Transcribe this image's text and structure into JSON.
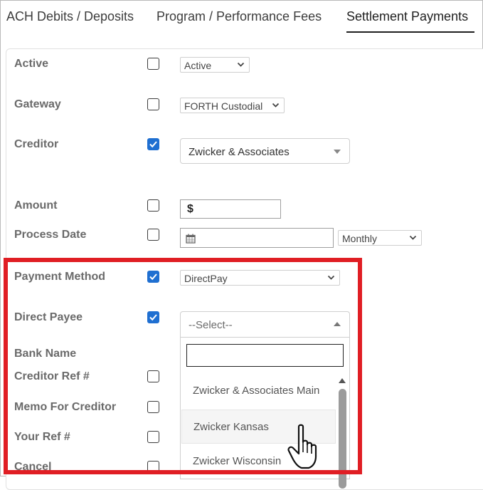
{
  "tabs": [
    {
      "label": "ACH Debits / Deposits"
    },
    {
      "label": "Program / Performance Fees"
    },
    {
      "label": "Settlement Payments",
      "active": true
    }
  ],
  "fields": {
    "active": {
      "label": "Active",
      "checked": false,
      "value": "Active"
    },
    "gateway": {
      "label": "Gateway",
      "checked": false,
      "value": "FORTH Custodial"
    },
    "creditor": {
      "label": "Creditor",
      "checked": true,
      "value": "Zwicker & Associates"
    },
    "amount": {
      "label": "Amount",
      "checked": false,
      "prefix": "$",
      "value": ""
    },
    "process_date": {
      "label": "Process Date",
      "checked": false,
      "value": "",
      "frequency": "Monthly"
    },
    "payment_method": {
      "label": "Payment Method",
      "checked": true,
      "value": "DirectPay"
    },
    "direct_payee": {
      "label": "Direct Payee",
      "checked": true,
      "placeholder": "--Select--",
      "search_value": "",
      "options": [
        "Zwicker & Associates Main",
        "Zwicker Kansas",
        "Zwicker Wisconsin"
      ],
      "hovered_option": "Zwicker Kansas"
    },
    "bank_name": {
      "label": "Bank Name"
    },
    "creditor_ref": {
      "label": "Creditor Ref #",
      "checked": false
    },
    "memo_for_creditor": {
      "label": "Memo For Creditor",
      "checked": false
    },
    "your_ref": {
      "label": "Your Ref #",
      "checked": false
    },
    "cancel": {
      "label": "Cancel",
      "checked": false
    }
  },
  "colors": {
    "highlight": "#e01e24",
    "checkbox_checked": "#1f6fd1"
  },
  "icons": {
    "calendar": "calendar-icon",
    "cursor": "hand-pointer-icon"
  }
}
